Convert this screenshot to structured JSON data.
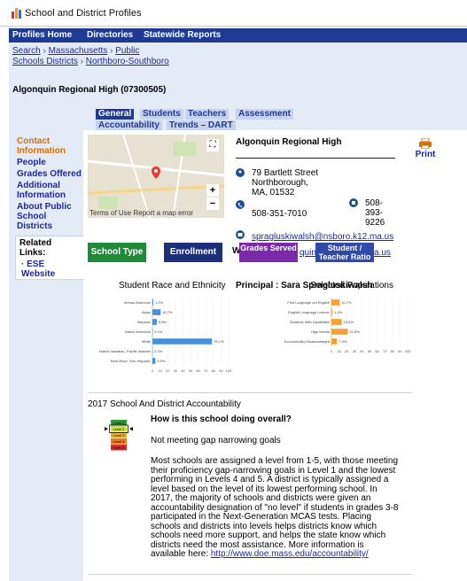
{
  "window": {
    "title": "School and District Profiles"
  },
  "nav": {
    "items": [
      "Profiles Home",
      "Directories",
      "Statewide Reports"
    ]
  },
  "breadcrumb": {
    "line1": [
      "Search",
      "Massachusetts",
      "Public"
    ],
    "line2": [
      "Schools Districts",
      "Northboro-Southboro"
    ]
  },
  "school": {
    "heading": "Algonquin Regional High (07300505)",
    "name": "Algonquin Regional High",
    "address": [
      "79 Bartlett Street",
      "Northborough,",
      "MA, 01532"
    ],
    "phone": "508-351-7010",
    "fax": [
      "508-",
      "393-",
      "9226"
    ],
    "email": "spragluskiwalsh@nsboro.k12.ma.us",
    "web_suffix": "quin.",
    "web_tail": "a.us"
  },
  "tabs": {
    "row1": [
      "General",
      "Students",
      "Teachers",
      "Assessment"
    ],
    "row2": [
      "Accountability",
      "Trends – DART"
    ]
  },
  "sidebar": {
    "items": [
      "Contact Information",
      "People",
      "Grades Offered",
      "Additional Information",
      "About Public School Districts"
    ],
    "related_title": "Related Links:",
    "related_link": "ESE Website"
  },
  "map": {
    "footer": "Terms of Use  Report a map error",
    "zoom_in": "+",
    "zoom_out": "−",
    "fullscreen": "⛶"
  },
  "print_label": "Print",
  "tiles": {
    "school_type": "School Type",
    "enrollment": "Enrollment",
    "web_prefix": "Web",
    "grades": "Grades Served",
    "student_ratio": "Student / Teacher Ratio"
  },
  "section_labels": {
    "race": "Student Race and Ethnicity",
    "principal": "Principal : Sara Spragluskiwalsh",
    "selected_populations": "Selected Populations"
  },
  "chart_data": [
    {
      "type": "bar",
      "orientation": "horizontal",
      "title": "Student Race and Ethnicity",
      "categories": [
        "African American",
        "Asian",
        "Hispanic",
        "Native American",
        "White",
        "Native Hawaiian, Pacific Islander",
        "Multi-Race, Non-Hispanic"
      ],
      "values": [
        1.2,
        10.7,
        5.8,
        0.1,
        78.1,
        0.2,
        3.9
      ],
      "labels": [
        "1.2%",
        "10.7%",
        "5.8%",
        "0.1%",
        "78.1%",
        "0.2%",
        "3.9%"
      ],
      "xlim": [
        0,
        100
      ],
      "x_ticks": [
        "0",
        "10",
        "20",
        "30",
        "40",
        "50",
        "60",
        "70",
        "80",
        "90",
        "100"
      ],
      "color": "#4a90d9"
    },
    {
      "type": "bar",
      "orientation": "horizontal",
      "title": "Selected Populations",
      "categories": [
        "First Language not English",
        "English Language Learner",
        "Students With Disabilities",
        "High Needs",
        "Economically Disadvantaged"
      ],
      "values": [
        10.7,
        1.4,
        13.5,
        21.5,
        7.3
      ],
      "labels": [
        "10.7%",
        "1.4%",
        "13.5%",
        "21.5%",
        "7.3%"
      ],
      "xlim": [
        0,
        100
      ],
      "x_ticks": [
        "0",
        "10",
        "20",
        "30",
        "40",
        "50",
        "60",
        "70",
        "80",
        "90",
        "100"
      ],
      "color": "#f5a030"
    }
  ],
  "accountability": {
    "heading": "2017 School And District Accountability",
    "question": "How is this school doing overall?",
    "status": "Not meeting gap narrowing goals",
    "levels": [
      "Level 1",
      "Level 2",
      "Level 3",
      "Level 4",
      "Level 5"
    ],
    "level_colors": [
      "#2a9d2a",
      "#cfe23a",
      "#f5b21a",
      "#ef7a1a",
      "#d92b2b"
    ],
    "selected_level": 2,
    "body_lines": [
      "Most schools are assigned a level from 1-5, with those meeting",
      "their proficiency gap-narrowing goals in Level 1 and the lowest",
      "performing in Levels 4 and 5. A district is typically assigned a",
      "level based on the level of its lowest performing school. In",
      "2017, the majority of schools and districts were given an",
      "accountability designation of \"no level\" if students in grades 3-8",
      "participated in the Next-Generation MCAS tests. Placing",
      "schools and districts into levels helps districts know which",
      "schools need more support, and helps the state know which",
      "districts need the most assistance. More information is"
    ],
    "more_prefix": "available here: ",
    "more_link": "http://www.doe.mass.edu/accountability/"
  }
}
